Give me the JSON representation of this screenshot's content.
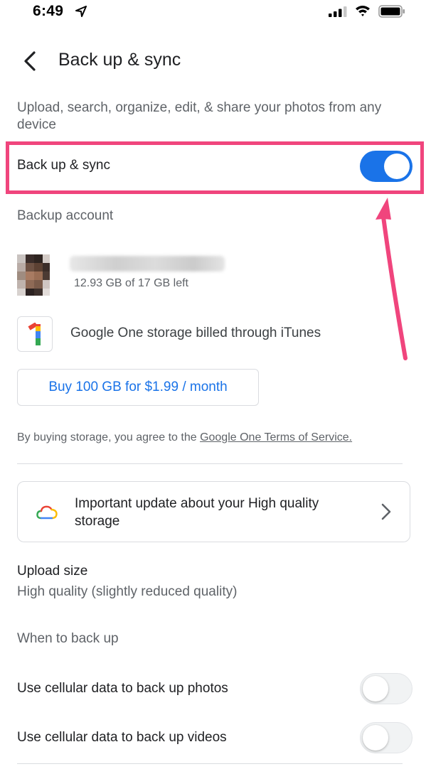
{
  "status_bar": {
    "time": "6:49"
  },
  "header": {
    "title": "Back up & sync"
  },
  "description": "Upload, search, organize, edit, & share your photos from any device",
  "sync_toggle": {
    "label": "Back up & sync",
    "on": true
  },
  "backup_account": {
    "section_label": "Backup account",
    "storage_text": "12.93 GB of 17 GB left"
  },
  "google_one": {
    "billing_text": "Google One storage billed through iTunes"
  },
  "buy_button": {
    "label": "Buy 100 GB for $1.99 / month"
  },
  "terms": {
    "prefix": "By buying storage, you agree to the ",
    "link": "Google One Terms of Service."
  },
  "update_card": {
    "text": "Important update about your High quality storage"
  },
  "upload_size": {
    "title": "Upload size",
    "value": "High quality (slightly reduced quality)"
  },
  "when_to_back_up": {
    "section_label": "When to back up",
    "items": [
      {
        "label": "Use cellular data to back up photos",
        "on": false
      },
      {
        "label": "Use cellular data to back up videos",
        "on": false
      }
    ]
  },
  "colors": {
    "accent": "#1a73e8",
    "annotation": "#f0457d"
  }
}
